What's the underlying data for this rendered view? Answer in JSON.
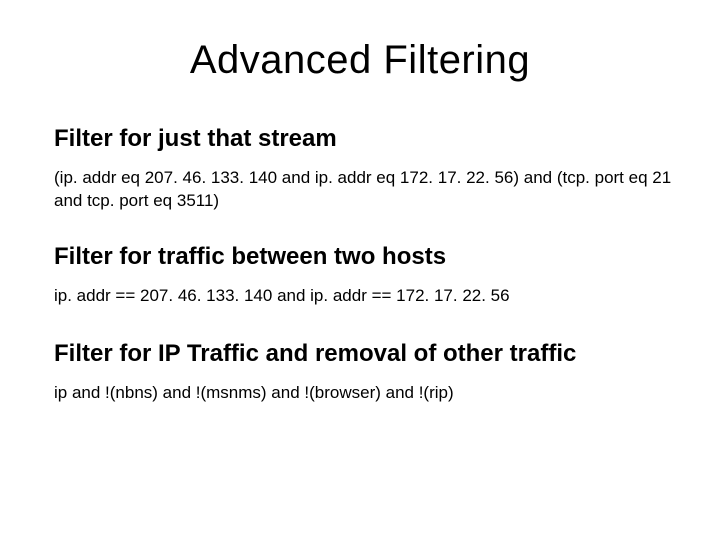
{
  "title": "Advanced Filtering",
  "sections": [
    {
      "heading": "Filter for just that stream",
      "body": "(ip. addr eq 207. 46. 133. 140 and ip. addr eq 172. 17. 22. 56) and (tcp. port eq 21 and tcp. port eq 3511)"
    },
    {
      "heading": "Filter for traffic between two hosts",
      "body": "ip. addr == 207. 46. 133. 140 and ip. addr == 172. 17. 22. 56"
    },
    {
      "heading": "Filter for IP Traffic and removal of other traffic",
      "body": "ip and !(nbns) and !(msnms) and !(browser) and !(rip)"
    }
  ]
}
